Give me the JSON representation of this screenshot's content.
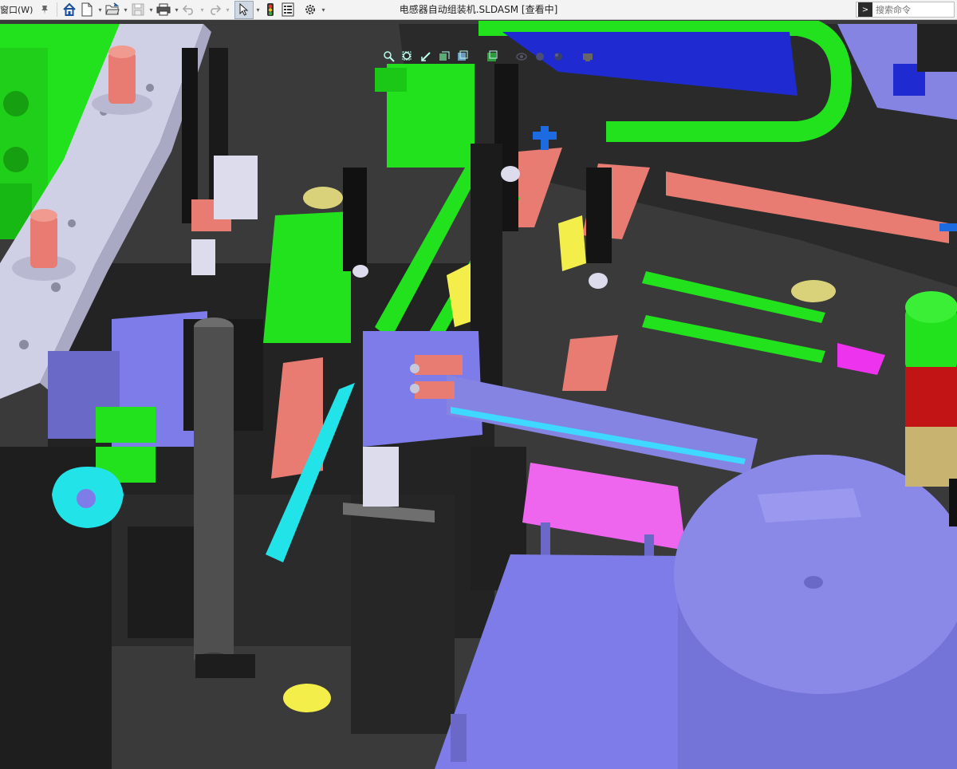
{
  "toolbar": {
    "window_menu_label": "窗口(W)",
    "document_title": "电感器自动组装机.SLDASM [查看中]",
    "search_placeholder": "搜索命令"
  },
  "icons": {
    "pin": "pin-icon",
    "home": "home-icon",
    "new": "new-document-icon",
    "open": "open-folder-icon",
    "save": "save-icon",
    "print": "print-icon",
    "undo": "undo-icon",
    "redo": "redo-icon",
    "select": "select-cursor-icon",
    "rebuild": "traffic-light-icon",
    "file_properties": "file-properties-icon",
    "options": "gear-icon"
  },
  "colors": {
    "viewport_bg": "#3a3a3a",
    "machine_dark": "#262626",
    "green": "#22e21d",
    "lavender": "#7d7ce9",
    "salmon": "#e87c72",
    "light_gray": "#cfcfe6",
    "cyan": "#22e3e8",
    "magenta": "#ee66ee",
    "blue": "#1f2ad0",
    "yellow": "#f4ee4a"
  }
}
